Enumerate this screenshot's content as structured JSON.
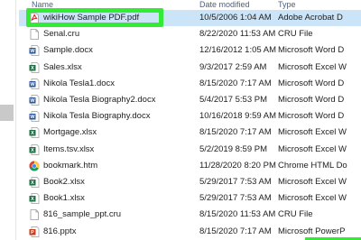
{
  "header": {
    "name": "Name",
    "date_modified": "Date modified",
    "type": "Type"
  },
  "files": [
    {
      "name": "wikiHow Sample PDF.pdf",
      "date": "10/5/2006 1:04 AM",
      "type": "Adobe Acrobat D",
      "icon": "pdf-icon",
      "selected": true
    },
    {
      "name": "Senal.cru",
      "date": "8/22/2020 11:53 AM",
      "type": "CRU File",
      "icon": "generic-file-icon"
    },
    {
      "name": "Sample.docx",
      "date": "12/16/2012 1:05 AM",
      "type": "Microsoft Word D",
      "icon": "word-icon"
    },
    {
      "name": "Sales.xlsx",
      "date": "9/3/2017 2:59 AM",
      "type": "Microsoft Excel W",
      "icon": "excel-icon"
    },
    {
      "name": "Nikola Tesla1.docx",
      "date": "8/15/2020 7:17 AM",
      "type": "Microsoft Word D",
      "icon": "word-icon"
    },
    {
      "name": "Nikola Tesla Biography2.docx",
      "date": "5/4/2017 5:53 PM",
      "type": "Microsoft Word D",
      "icon": "word-icon"
    },
    {
      "name": "Nikola Tesla Biography.docx",
      "date": "10/16/2018 9:59 AM",
      "type": "Microsoft Word D",
      "icon": "word-icon"
    },
    {
      "name": "Mortgage.xlsx",
      "date": "8/15/2020 7:17 AM",
      "type": "Microsoft Excel W",
      "icon": "excel-icon"
    },
    {
      "name": "Items.tsv.xlsx",
      "date": "5/2/2019 8:59 PM",
      "type": "Microsoft Excel W",
      "icon": "excel-icon"
    },
    {
      "name": "bookmark.htm",
      "date": "11/28/2020 8:20 PM",
      "type": "Chrome HTML Do",
      "icon": "chrome-icon"
    },
    {
      "name": "Book2.xlsx",
      "date": "5/29/2017 7:53 AM",
      "type": "Microsoft Excel W",
      "icon": "excel-icon"
    },
    {
      "name": "Book1.xlsx",
      "date": "5/29/2017 7:53 AM",
      "type": "Microsoft Excel W",
      "icon": "excel-icon"
    },
    {
      "name": "816_sample_ppt.cru",
      "date": "8/15/2020 11:53 AM",
      "type": "CRU File",
      "icon": "generic-file-icon"
    },
    {
      "name": "816.pptx",
      "date": "8/15/2020 7:17 AM",
      "type": "Microsoft PowerP",
      "icon": "powerpoint-icon"
    }
  ],
  "colors": {
    "selection": "#cce4f7",
    "highlight_box": "#33ea34"
  }
}
